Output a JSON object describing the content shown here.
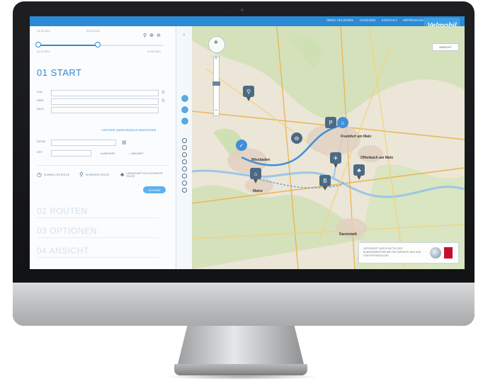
{
  "top_nav": {
    "items": [
      "ÜBER VELMOBIL",
      "LEGENDE",
      "KONTAKT",
      "IMPRESSUM"
    ],
    "logo_text": "Velmobil"
  },
  "timeline": {
    "top_left": "19.12.2011",
    "top_right": "31.05.2012",
    "bottom_left": "01.12.2011",
    "bottom_right": "01.06.2012",
    "progress_fraction": 0.48
  },
  "start_panel": {
    "heading": "01 START",
    "fields": [
      "VON",
      "ÜBER",
      "NACH"
    ],
    "alt_link": "+ WEITERE ZWISCHENZIELE HINZUFÜGEN",
    "date_label": "DATUM",
    "time_label": "ZEIT",
    "radio_depart": "ABFAHRT",
    "radio_arrive": "ANKUNFT",
    "modes": [
      {
        "icon": "clock-icon",
        "label": "SCHNELLSTE ROUTE"
      },
      {
        "icon": "bike-icon",
        "label": "SICHERSTE ROUTE"
      },
      {
        "icon": "tree-icon",
        "label": "LANDSCHAFTLICH SCHÖNSTE ROUTE"
      }
    ],
    "submit": "SUCHEN"
  },
  "steps": [
    "02 ROUTEN",
    "03 OPTIONEN",
    "04 ANSICHT"
  ],
  "map": {
    "view_button": "ANSICHT",
    "cities": [
      {
        "name": "Wiesbaden"
      },
      {
        "name": "Frankfurt am Main"
      },
      {
        "name": "Offenbach am Main"
      },
      {
        "name": "Mainz"
      },
      {
        "name": "Darmstadt"
      }
    ],
    "credit_text": "GEFÖRDERT DURCH MITTEL DES BUNDESMINISTERIUMS FÜR VERKEHR, BAU UND STADTENTWICKLUNG"
  },
  "colors": {
    "accent": "#2b8ad6",
    "route": "#3f8fd8",
    "map_bg": "#ece6d8"
  }
}
